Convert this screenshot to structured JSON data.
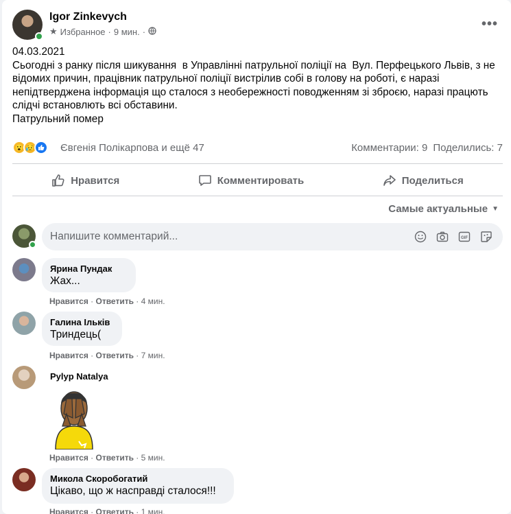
{
  "post": {
    "author": "Igor Zinkevych",
    "meta_category": "Избранное",
    "meta_time": "9 мин.",
    "date_line": "04.03.2021",
    "body": "Сьогодні з ранку після шикування  в Управлінні патрульної поліції на  Вул. Перфецького Львів, з не відомих причин, працівник патрульної поліції вистрілив собі в голову на роботі, є наразі непідтверджена інформація що сталося з необережності поводженням зі зброєю, наразі працють слідчі встановлють всі обставини.",
    "closing_line": "Патрульний помер"
  },
  "reactions": {
    "names": "Євгенія Полікарпова и ещё 47",
    "comments_count": "Комментарии: 9",
    "shares_count": "Поделились: 7"
  },
  "actions": {
    "like": "Нравится",
    "comment": "Комментировать",
    "share": "Поделиться"
  },
  "sort": {
    "label": "Самые актуальные"
  },
  "composer": {
    "placeholder": "Напишите комментарий..."
  },
  "comments": [
    {
      "name": "Ярина Пундак",
      "text": "Жах...",
      "like": "Нравится",
      "reply": "Ответить",
      "time": "4 мин."
    },
    {
      "name": "Галина Ільків",
      "text": "Триндець(",
      "like": "Нравится",
      "reply": "Ответить",
      "time": "7 мин."
    },
    {
      "name": "Pylyp Natalya",
      "text": "",
      "like": "Нравится",
      "reply": "Ответить",
      "time": "5 мин."
    },
    {
      "name": "Микола Скоробогатий",
      "text": "Цікаво, що ж насправді сталося!!!",
      "like": "Нравится",
      "reply": "Ответить",
      "time": "1 мин."
    }
  ],
  "colors": {
    "brand_blue": "#1877f2",
    "online_green": "#31a24c",
    "secondary_text": "#65676b"
  }
}
